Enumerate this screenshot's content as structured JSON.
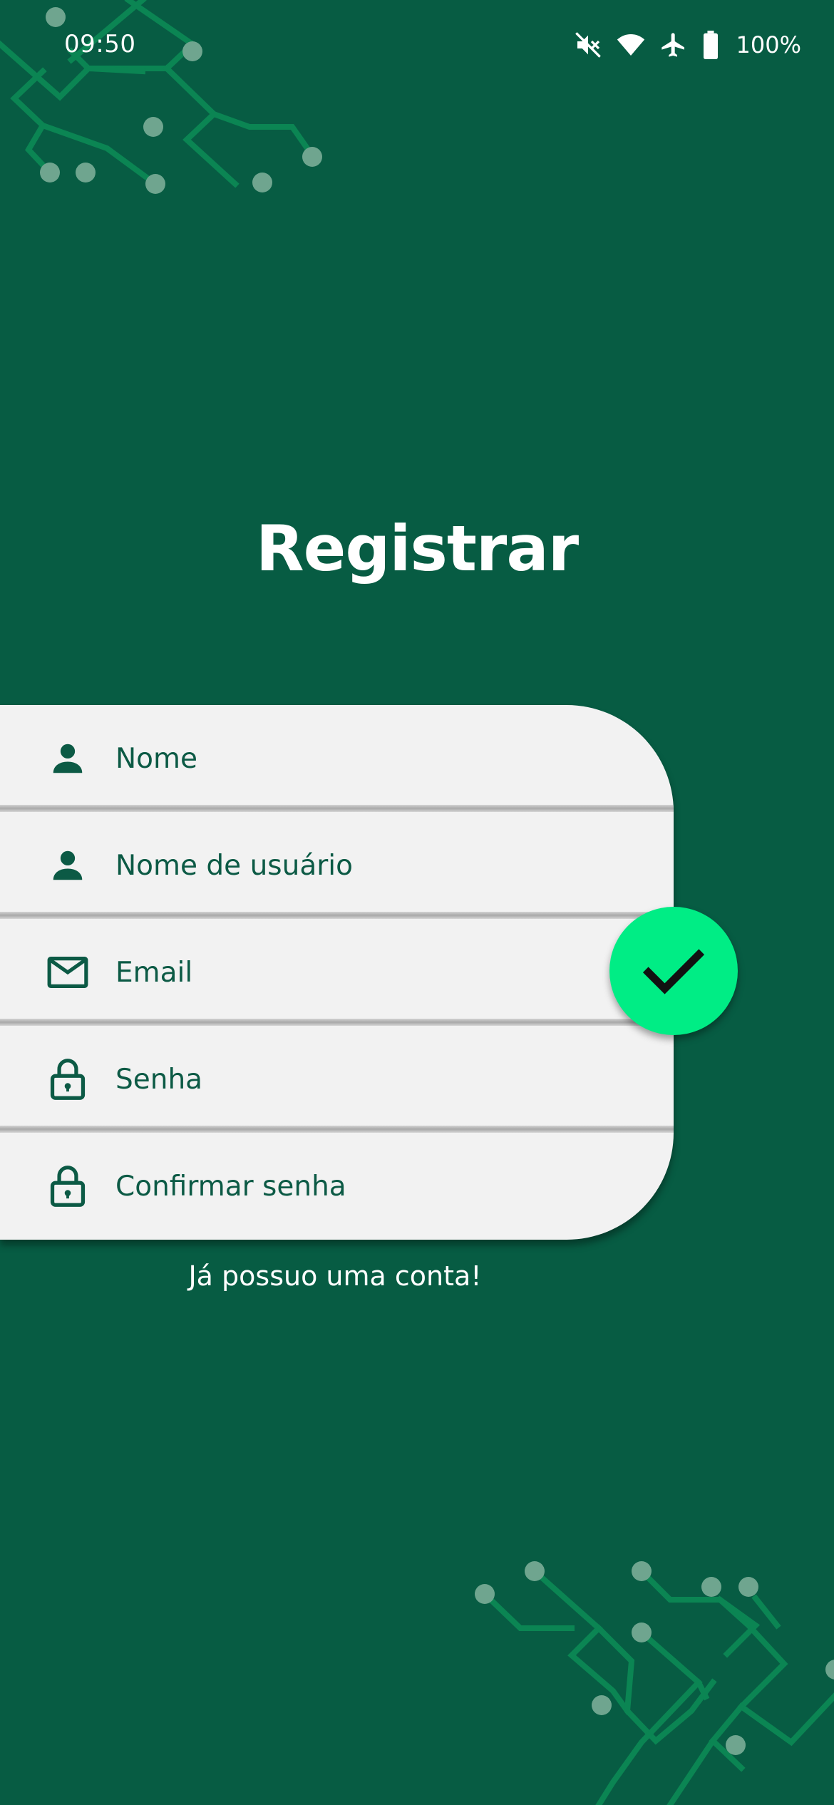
{
  "status_bar": {
    "time": "09:50",
    "battery_text": "100%",
    "icons": [
      "mute-icon",
      "wifi-icon",
      "airplane-mode-icon",
      "battery-icon"
    ]
  },
  "title": "Registrar",
  "form": {
    "fields": [
      {
        "name": "nome",
        "placeholder": "Nome",
        "value": "",
        "icon": "person-icon"
      },
      {
        "name": "usuario",
        "placeholder": "Nome de usuário",
        "value": "",
        "icon": "person-icon"
      },
      {
        "name": "email",
        "placeholder": "Email",
        "value": "",
        "icon": "mail-icon"
      },
      {
        "name": "senha",
        "placeholder": "Senha",
        "value": "",
        "icon": "lock-icon"
      },
      {
        "name": "confirmar",
        "placeholder": "Confirmar senha",
        "value": "",
        "icon": "lock-icon"
      }
    ],
    "submit_icon": "checkmark-icon"
  },
  "login_link": "Já possuo uma conta!",
  "colors": {
    "background": "#075c43",
    "card": "#f2f2f2",
    "text_dark_green": "#0c5a45",
    "accent": "#00ed85",
    "circuit_line": "#0b8553",
    "circuit_dot": "#6fa58f"
  }
}
